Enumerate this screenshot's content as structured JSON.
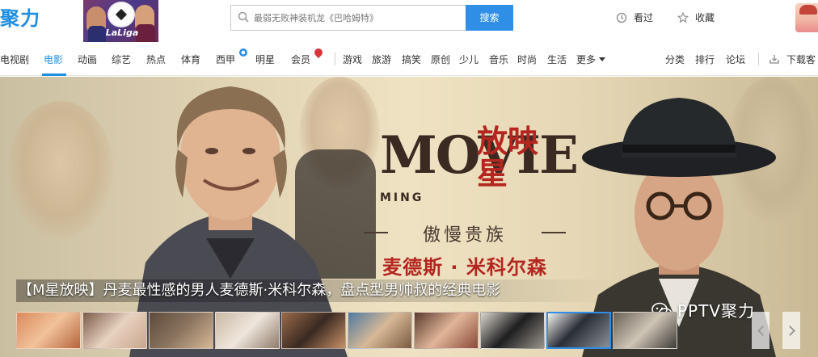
{
  "header": {
    "logo_text": "聚力",
    "laliga_label": "LaLiga",
    "search": {
      "placeholder": "最弱无败神装机龙《巴哈姆特》",
      "button_label": "搜索"
    },
    "history_label": "看过",
    "favorites_label": "收藏"
  },
  "nav": {
    "items": [
      {
        "label": "电视剧"
      },
      {
        "label": "电影"
      },
      {
        "label": "动画"
      },
      {
        "label": "综艺"
      },
      {
        "label": "热点"
      },
      {
        "label": "体育"
      },
      {
        "label": "西甲"
      },
      {
        "label": "明星"
      },
      {
        "label": "会员"
      },
      {
        "label": "游戏"
      },
      {
        "label": "旅游"
      },
      {
        "label": "搞笑"
      },
      {
        "label": "原创"
      },
      {
        "label": "少儿"
      },
      {
        "label": "音乐"
      },
      {
        "label": "时尚"
      },
      {
        "label": "生活"
      },
      {
        "label": "更多"
      }
    ],
    "active_label": "电影",
    "right_links": [
      {
        "label": "分类"
      },
      {
        "label": "排行"
      },
      {
        "label": "论坛"
      },
      {
        "label": "下载客"
      }
    ]
  },
  "banner": {
    "title_main": "MOVIE",
    "title_zh": "放映星",
    "title_ming": "MING",
    "subtitle": "傲慢贵族",
    "name": "麦德斯 · 米科尔森",
    "caption": "【M星放映】丹麦最性感的男人麦德斯·米科尔森，盘点型男帅叔的经典电影",
    "watermark": "PPTV聚力",
    "thumbnail_count": 10,
    "selected_thumbnail": 8
  },
  "colors": {
    "accent": "#1f8ee0",
    "search_button": "#2f8fe7",
    "title_red": "#b4261f"
  }
}
